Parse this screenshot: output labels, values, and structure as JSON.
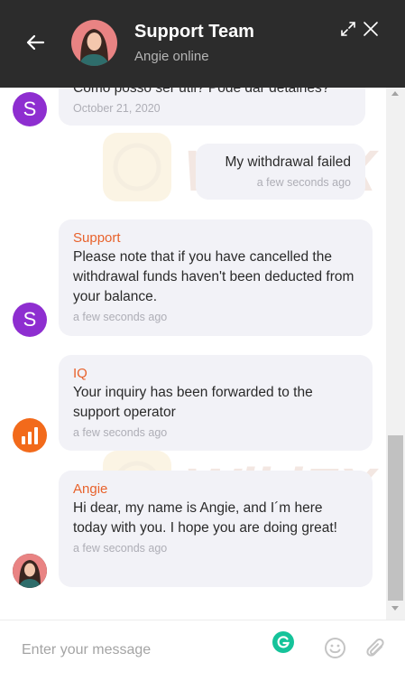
{
  "header": {
    "title": "Support Team",
    "status": "Angie online",
    "back_icon": "arrow-left-icon",
    "expand_icon": "expand-icon",
    "close_icon": "close-icon"
  },
  "messages": [
    {
      "direction": "in",
      "sender": "",
      "text": "Como posso ser útil? Pode dar detalhes?",
      "time": "October 21, 2020",
      "avatar": "S"
    },
    {
      "direction": "out",
      "sender": "",
      "text": "My withdrawal failed",
      "time": "a few seconds ago"
    },
    {
      "direction": "in",
      "sender": "Support",
      "text": "Please note that if you have cancelled the withdrawal funds haven't been deducted from your balance.",
      "time": "a few seconds ago",
      "avatar": "S"
    },
    {
      "direction": "in",
      "sender": "IQ",
      "text": "Your inquiry has been forwarded to the support operator",
      "time": "a few seconds ago",
      "avatar": "iq-logo-icon"
    },
    {
      "direction": "in",
      "sender": "Angie",
      "text": "Hi dear, my name is Angie, and I´m here today with you. I hope you are doing great!",
      "time": "a few seconds ago",
      "avatar": "agent-photo"
    }
  ],
  "watermark": {
    "text": "WikiFX"
  },
  "composer": {
    "placeholder": "Enter your message",
    "grammarly_icon": "grammarly-icon",
    "emoji_icon": "emoji-icon",
    "attach_icon": "paperclip-icon"
  },
  "colors": {
    "header_bg": "#2c2c2c",
    "sender_name": "#e8622c",
    "bubble_bg": "#f2f2f7",
    "support_avatar": "#8e2ed0",
    "iq_avatar": "#f26a1b",
    "grammarly": "#15c39a"
  }
}
